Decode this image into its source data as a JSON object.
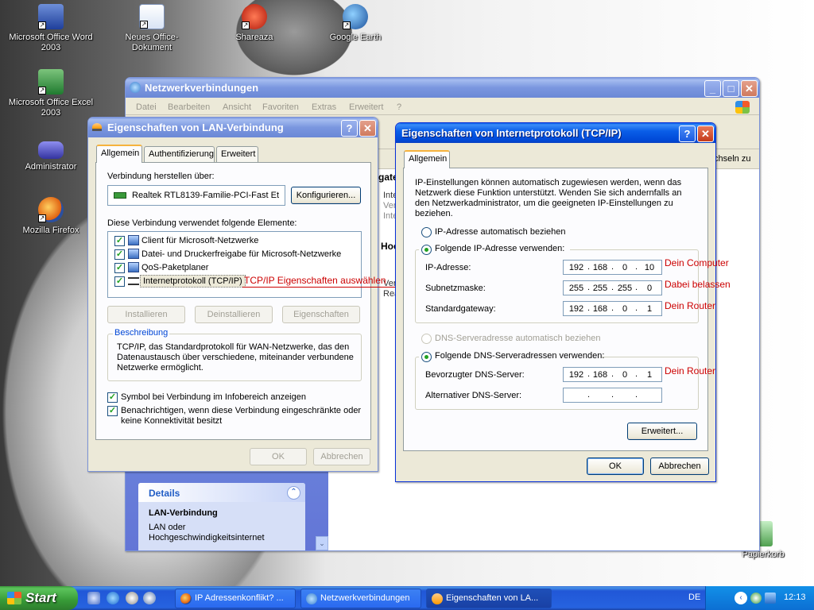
{
  "desktop": {
    "icons": [
      {
        "label": "Microsoft Office Word 2003",
        "icon": "word-icon"
      },
      {
        "label": "Neues Office-Dokument",
        "icon": "office-document-icon"
      },
      {
        "label": "Shareaza",
        "icon": "shareaza-icon"
      },
      {
        "label": "Google Earth",
        "icon": "google-earth-icon"
      },
      {
        "label": "Microsoft Office Excel 2003",
        "icon": "excel-icon"
      },
      {
        "label": "Administrator",
        "icon": "user-folder-icon"
      },
      {
        "label": "Mozilla Firefox",
        "icon": "firefox-icon"
      },
      {
        "label": "Papierkorb",
        "icon": "recycle-bin-icon"
      }
    ]
  },
  "netzwerk": {
    "title": "Netzwerkverbindungen",
    "menu": [
      "Datei",
      "Bearbeiten",
      "Ansicht",
      "Favoriten",
      "Extras",
      "Erweitert",
      "?"
    ],
    "partial": {
      "gate": "gate",
      "inte1": "Inte",
      "ver1": "Ver",
      "inte2": "Inte",
      "hoc": "Hoc",
      "ver2": "Ver",
      "rea": "Rea",
      "wechseln": "chseln zu"
    },
    "details": {
      "header": "Details",
      "name": "LAN-Verbindung",
      "desc": "LAN oder Hochgeschwindigkeitsinternet"
    }
  },
  "lan": {
    "title": "Eigenschaften von LAN-Verbindung",
    "tabs": [
      "Allgemein",
      "Authentifizierung",
      "Erweitert"
    ],
    "connect_label": "Verbindung herstellen über:",
    "adapter": "Realtek RTL8139-Familie-PCI-Fast Et",
    "configure": "Konfigurieren...",
    "elements_label": "Diese Verbindung verwendet folgende Elemente:",
    "items": [
      {
        "label": "Client für Microsoft-Netzwerke",
        "checked": true
      },
      {
        "label": "Datei- und Druckerfreigabe für Microsoft-Netzwerke",
        "checked": true
      },
      {
        "label": "QoS-Paketplaner",
        "checked": true
      },
      {
        "label": "Internetprotokoll (TCP/IP)",
        "checked": true
      }
    ],
    "annotation": "TCP/IP Eigenschaften auswählen",
    "install": "Installieren",
    "uninstall": "Deinstallieren",
    "properties": "Eigenschaften",
    "desc_title": "Beschreibung",
    "desc_text": "TCP/IP, das Standardprotokoll für WAN-Netzwerke, das den Datenaustausch über verschiedene, miteinander verbundene Netzwerke ermöglicht.",
    "cb_symbol": "Symbol bei Verbindung im Infobereich anzeigen",
    "cb_notify": "Benachrichtigen, wenn diese Verbindung eingeschränkte oder keine Konnektivität besitzt",
    "ok": "OK",
    "cancel": "Abbrechen"
  },
  "tcpip": {
    "title": "Eigenschaften von Internetprotokoll (TCP/IP)",
    "tab": "Allgemein",
    "intro": "IP-Einstellungen können automatisch zugewiesen werden, wenn das Netzwerk diese Funktion unterstützt. Wenden Sie sich andernfalls an den Netzwerkadministrator, um die geeigneten IP-Einstellungen zu beziehen.",
    "auto_ip": "IP-Adresse automatisch beziehen",
    "manual_ip": "Folgende IP-Adresse verwenden:",
    "ip_label": "IP-Adresse:",
    "ip": [
      "192",
      "168",
      "0",
      "10"
    ],
    "ip_note": "Dein Computer",
    "mask_label": "Subnetzmaske:",
    "mask": [
      "255",
      "255",
      "255",
      "0"
    ],
    "mask_note": "Dabei belassen",
    "gw_label": "Standardgateway:",
    "gw": [
      "192",
      "168",
      "0",
      "1"
    ],
    "gw_note": "Dein Router",
    "auto_dns": "DNS-Serveradresse automatisch beziehen",
    "manual_dns": "Folgende DNS-Serveradressen verwenden:",
    "dns1_label": "Bevorzugter DNS-Server:",
    "dns1": [
      "192",
      "168",
      "0",
      "1"
    ],
    "dns1_note": "Dein Router",
    "dns2_label": "Alternativer DNS-Server:",
    "dns2": [
      "",
      "",
      "",
      ""
    ],
    "advanced": "Erweitert...",
    "ok": "OK",
    "cancel": "Abbrechen"
  },
  "taskbar": {
    "start": "Start",
    "tasks": [
      "IP Adressenkonflikt? ...",
      "Netzwerkverbindungen",
      "Eigenschaften von LA..."
    ],
    "lang": "DE",
    "clock": "12:13"
  }
}
